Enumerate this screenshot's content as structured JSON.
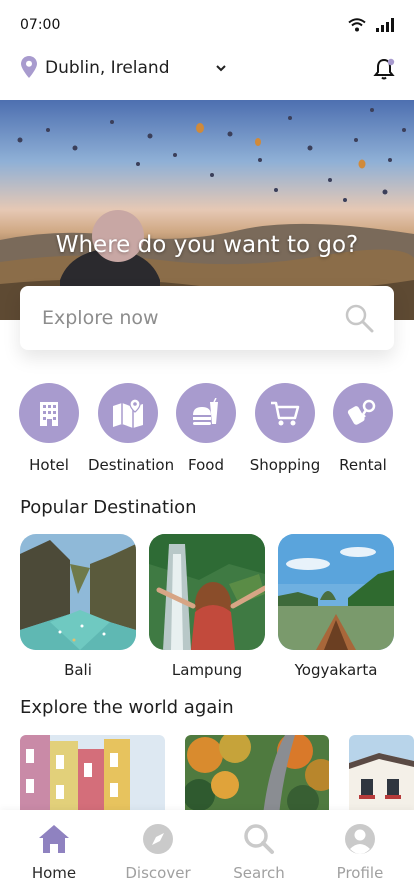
{
  "status": {
    "time": "07:00"
  },
  "location": {
    "text": "Dublin, Ireland"
  },
  "hero": {
    "title": "Where do you want to go?"
  },
  "search": {
    "placeholder": "Explore now"
  },
  "categories": [
    {
      "label": "Hotel",
      "icon": "hotel-icon"
    },
    {
      "label": "Destination",
      "icon": "map-icon"
    },
    {
      "label": "Food",
      "icon": "food-icon"
    },
    {
      "label": "Shopping",
      "icon": "cart-icon"
    },
    {
      "label": "Rental",
      "icon": "key-icon"
    }
  ],
  "popular": {
    "title": "Popular Destination",
    "items": [
      {
        "label": "Bali"
      },
      {
        "label": "Lampung"
      },
      {
        "label": "Yogyakarta"
      }
    ]
  },
  "explore": {
    "title": "Explore the world again"
  },
  "nav": {
    "items": [
      {
        "label": "Home",
        "icon": "home-icon",
        "active": true
      },
      {
        "label": "Discover",
        "icon": "compass-icon",
        "active": false
      },
      {
        "label": "Search",
        "icon": "search-icon",
        "active": false
      },
      {
        "label": "Profile",
        "icon": "profile-icon",
        "active": false
      }
    ]
  },
  "colors": {
    "accent": "#a89bce",
    "nav_active": "#8f82c0",
    "nav_inactive": "#c9c9c9"
  }
}
